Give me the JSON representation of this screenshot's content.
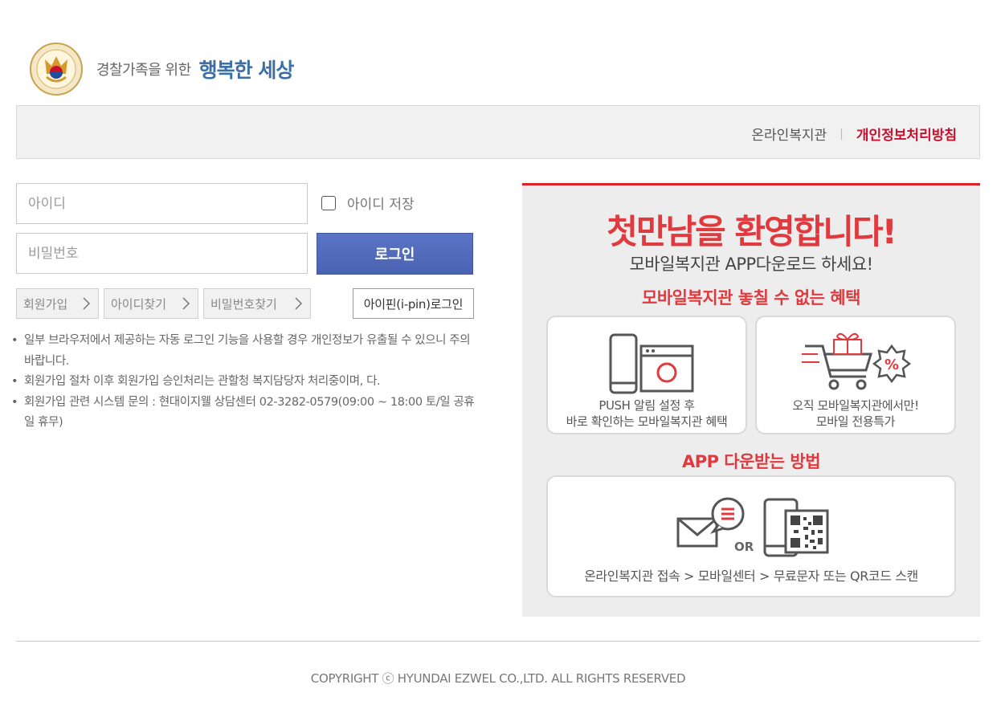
{
  "header": {
    "slogan_small": "경찰가족을 위한",
    "slogan_big": "행복한 세상"
  },
  "top_nav": {
    "online_welfare": "온라인복지관",
    "separator": "|",
    "privacy_policy": "개인정보처리방침"
  },
  "login": {
    "id_placeholder": "아이디",
    "id_value": "",
    "pw_placeholder": "비밀번호",
    "pw_value": "",
    "save_id_label": "아이디 저장",
    "save_id_checked": false,
    "login_button": "로그인",
    "join_button": "회원가입",
    "find_id_button": "아이디찾기",
    "find_pw_button": "비밀번호찾기",
    "ipin_button": "아이핀(i-pin)로그인"
  },
  "notices": [
    "일부 브라우저에서 제공하는 자동 로그인 기능을 사용할 경우 개인정보가 유출될 수 있으니 주의 바랍니다.",
    "회원가입 절차 이후 회원가입 승인처리는 관할청 복지담당자 처리중이며, 다.",
    "회원가입 관련 시스템 문의 : 현대이지웰 상담센터 02-3282-0579(09:00 ~ 18:00 토/일 공휴일 휴무)"
  ],
  "promo": {
    "title": "첫만남을 환영합니다!",
    "subtitle": "모바일복지관 APP다운로드 하세요!",
    "benefits_heading": "모바일복지관 놓칠 수 없는 혜택",
    "push_card_line1": "PUSH 알림 설정 후",
    "push_card_line2": "바로 확인하는 모바일복지관 혜택",
    "special_card_line1": "오직 모바일복지관에서만!",
    "special_card_line2": "모바일 전용특가",
    "percent_glyph": "%",
    "how_heading": "APP 다운받는 방법",
    "or_label": "OR",
    "how_text": "온라인복지관 접속 > 모바일센터 > 무료문자 또는 QR코드 스캔"
  },
  "footer": {
    "copyright": "COPYRIGHT ⓒ HYUNDAI EZWEL CO.,LTD. ALL RIGHTS RESERVED"
  },
  "colors": {
    "accent_red": "#e03a3e",
    "privacy_red": "#c8102e",
    "login_blue": "#4a62b2",
    "slogan_blue": "#3d6fa6"
  }
}
